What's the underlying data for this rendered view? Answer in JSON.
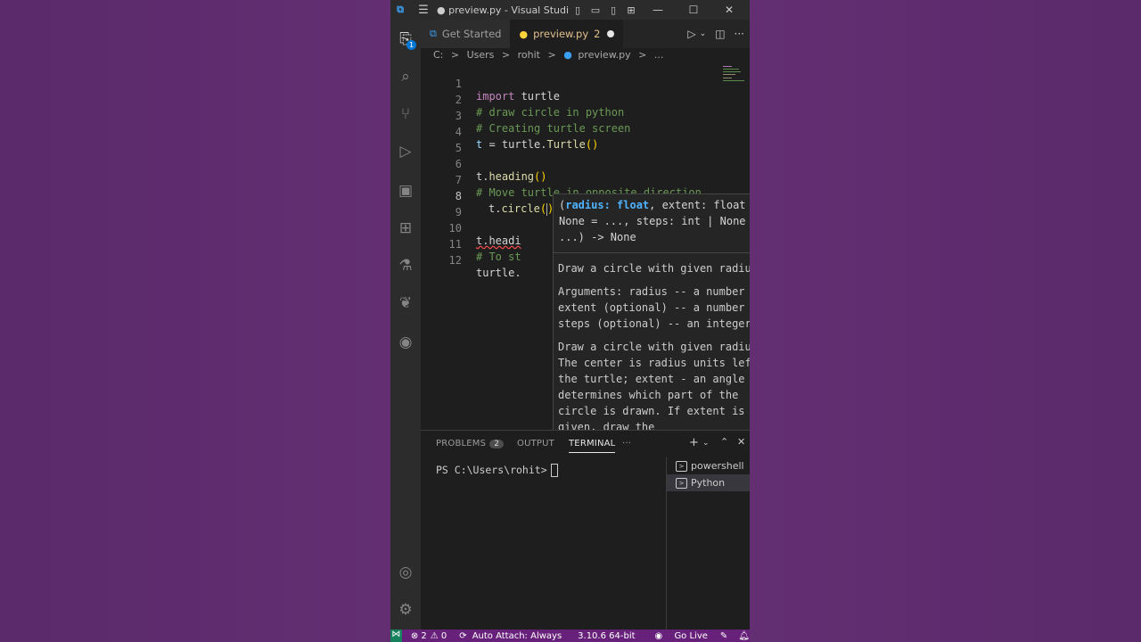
{
  "window": {
    "title": "● preview.py - Visual Studio C..."
  },
  "activity": {
    "explorer_badge": "1"
  },
  "tabs": [
    {
      "label": "Get Started",
      "active": false
    },
    {
      "label": "preview.py",
      "problems": "2",
      "active": true,
      "modified": true
    }
  ],
  "breadcrumb": [
    "C:",
    ">",
    "Users",
    ">",
    "rohit",
    ">",
    "preview.py",
    ">",
    "..."
  ],
  "editor": {
    "lines": [
      {
        "n": "1"
      },
      {
        "n": "2"
      },
      {
        "n": "3"
      },
      {
        "n": "4"
      },
      {
        "n": "5"
      },
      {
        "n": "6"
      },
      {
        "n": "7"
      },
      {
        "n": "8"
      },
      {
        "n": "9"
      },
      {
        "n": "10"
      },
      {
        "n": "11"
      },
      {
        "n": "12"
      }
    ],
    "code": {
      "l1_kw": "import",
      "l1_mod": " turtle",
      "l2": "# draw circle in python",
      "l3": "# Creating turtle screen",
      "l4_var": "t",
      "l4_eq": " = turtle.",
      "l4_fn": "Turtle",
      "l4_br": "()",
      "l6_obj": "t.",
      "l6_fn": "heading",
      "l6_br": "()",
      "l7": "# Move turtle in opposite direction",
      "l8_obj": "t.",
      "l8_fn": "circle",
      "l8_br_open": "(",
      "l8_br_close": ")",
      "l10": "t.headi",
      "l11": "# To st",
      "l12": "turtle."
    }
  },
  "hover": {
    "sig_open": "(",
    "sig_param": "radius: float",
    "sig_rest": ", extent: float | None = ..., steps: int | None = ...) -> None",
    "summary": "Draw a circle with given radius.",
    "arguments": "Arguments: radius -- a number extent (optional) -- a number steps (optional) -- an integer",
    "details": "Draw a circle with given radius. The center is radius units left of the turtle; extent - an angle - determines which part of the circle is drawn. If extent is not given, draw the"
  },
  "panel": {
    "tabs": {
      "problems": "PROBLEMS",
      "problems_count": "2",
      "output": "OUTPUT",
      "terminal": "TERMINAL",
      "more": "···"
    },
    "terminal_prompt": "PS C:\\Users\\rohit>",
    "terminals": [
      {
        "label": "powershell",
        "selected": false
      },
      {
        "label": "Python",
        "selected": true
      }
    ]
  },
  "status": {
    "errors": "⊗ 2",
    "warnings": "⚠ 0",
    "auto_attach": "Auto Attach: Always",
    "python_version": "3.10.6 64-bit",
    "go_live": "Go Live"
  }
}
